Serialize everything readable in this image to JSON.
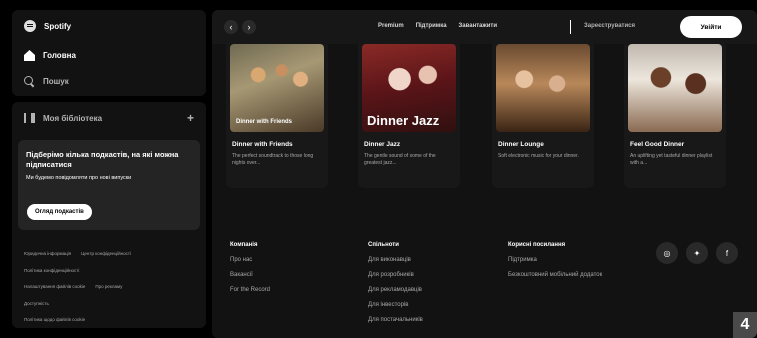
{
  "sidebar": {
    "logo_text": "Spotify",
    "nav": [
      {
        "label": "Головна",
        "icon": "home-icon"
      },
      {
        "label": "Пошук",
        "icon": "search-icon"
      }
    ],
    "library": {
      "title": "Моя бібліотека",
      "add_icon": "+",
      "podcast_prompt": {
        "title": "Підберімо кілька подкастів, на які можна підписатися",
        "subtitle": "Ми будемо повідомляти про нові випуски",
        "button": "Огляд подкастів"
      },
      "legal_links": [
        [
          "Юридична інформація",
          "Центр конфіденційності"
        ],
        [
          "Політика конфіденційності"
        ],
        [
          "Налаштування файлів cookie",
          "Про рекламу"
        ],
        [
          "Доступність"
        ],
        [
          "Політика щодо файлів cookie"
        ]
      ]
    }
  },
  "topbar": {
    "back_icon": "‹",
    "forward_icon": "›",
    "links": [
      "Premium",
      "Підтримка",
      "Завантажити"
    ],
    "signup": "Зареєструватися",
    "login": "Увійти"
  },
  "playlists": [
    {
      "title": "Dinner with Friends",
      "desc": "The perfect soundtrack to those long nights over...",
      "cover_text": "Dinner with Friends",
      "cover_style": "small"
    },
    {
      "title": "Dinner Jazz",
      "desc": "The gentle sound of some of the greatest jazz...",
      "cover_text": "Dinner Jazz",
      "cover_style": "big"
    },
    {
      "title": "Dinner Lounge",
      "desc": "Soft electronic music for your dinner.",
      "cover_text": "",
      "cover_style": "none"
    },
    {
      "title": "Feel Good Dinner",
      "desc": "An uplifting yet tasteful dinner playlist with a...",
      "cover_text": "",
      "cover_style": "none"
    }
  ],
  "footer": {
    "columns": [
      {
        "heading": "Компанія",
        "links": [
          "Про нас",
          "Вакансії",
          "For the Record"
        ]
      },
      {
        "heading": "Спільноти",
        "links": [
          "Для виконавців",
          "Для розробників",
          "Для рекламодавців",
          "Для інвесторів",
          "Для постачальників"
        ]
      },
      {
        "heading": "Корисні посилання",
        "links": [
          "Підтримка",
          "Безкоштовний мобільний додаток"
        ]
      }
    ],
    "social": [
      {
        "icon": "instagram-icon",
        "glyph": "◎"
      },
      {
        "icon": "twitter-icon",
        "glyph": "✦"
      },
      {
        "icon": "facebook-icon",
        "glyph": "f"
      }
    ]
  },
  "page_number": "4"
}
